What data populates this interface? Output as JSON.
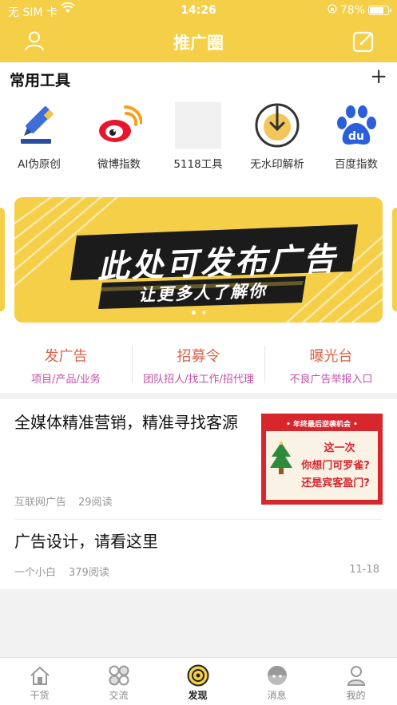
{
  "status_bar": {
    "carrier": "无 SIM 卡",
    "time": "14:26",
    "battery": "78%",
    "battery_level": 0.78
  },
  "header": {
    "title": "推广圈"
  },
  "tools": {
    "title": "常用工具",
    "add_label": "+",
    "items": [
      {
        "label": "AI伪原创",
        "icon": "pen-icon"
      },
      {
        "label": "微博指数",
        "icon": "weibo-icon"
      },
      {
        "label": "5118工具",
        "icon": "placeholder-icon"
      },
      {
        "label": "无水印解析",
        "icon": "download-circle-icon"
      },
      {
        "label": "百度指数",
        "icon": "baidu-paw-icon"
      }
    ]
  },
  "banner": {
    "headline": "此处可发布广告",
    "subline": "让更多人了解你",
    "slides": 2,
    "active_slide": 1
  },
  "actions": [
    {
      "title": "发广告",
      "subtitle": "项目/产品/业务"
    },
    {
      "title": "招募令",
      "subtitle": "团队招人/找工作/招代理"
    },
    {
      "title": "曝光台",
      "subtitle": "不良广告举报入口"
    }
  ],
  "feed": [
    {
      "title": "全媒体精准营销，精准寻找客源",
      "author": "互联网广告",
      "reads": "29阅读",
      "thumbnail": {
        "top": "• 年终最后逆袭机会 •",
        "line1": "这一次",
        "line2": "你想门可罗雀?",
        "line3": "还是宾客盈门?"
      }
    },
    {
      "title": "广告设计，请看这里",
      "author": "一个小白",
      "reads": "379阅读",
      "date": "11-18"
    }
  ],
  "tabbar": [
    {
      "label": "干货",
      "icon": "house-icon"
    },
    {
      "label": "交流",
      "icon": "grid-icon"
    },
    {
      "label": "发现",
      "icon": "compass-icon",
      "active": true
    },
    {
      "label": "消息",
      "icon": "message-icon"
    },
    {
      "label": "我的",
      "icon": "profile-icon"
    }
  ],
  "colors": {
    "brand_yellow": "#f4cf47",
    "action_red": "#d9654b",
    "action_sub": "#c44fa7"
  }
}
